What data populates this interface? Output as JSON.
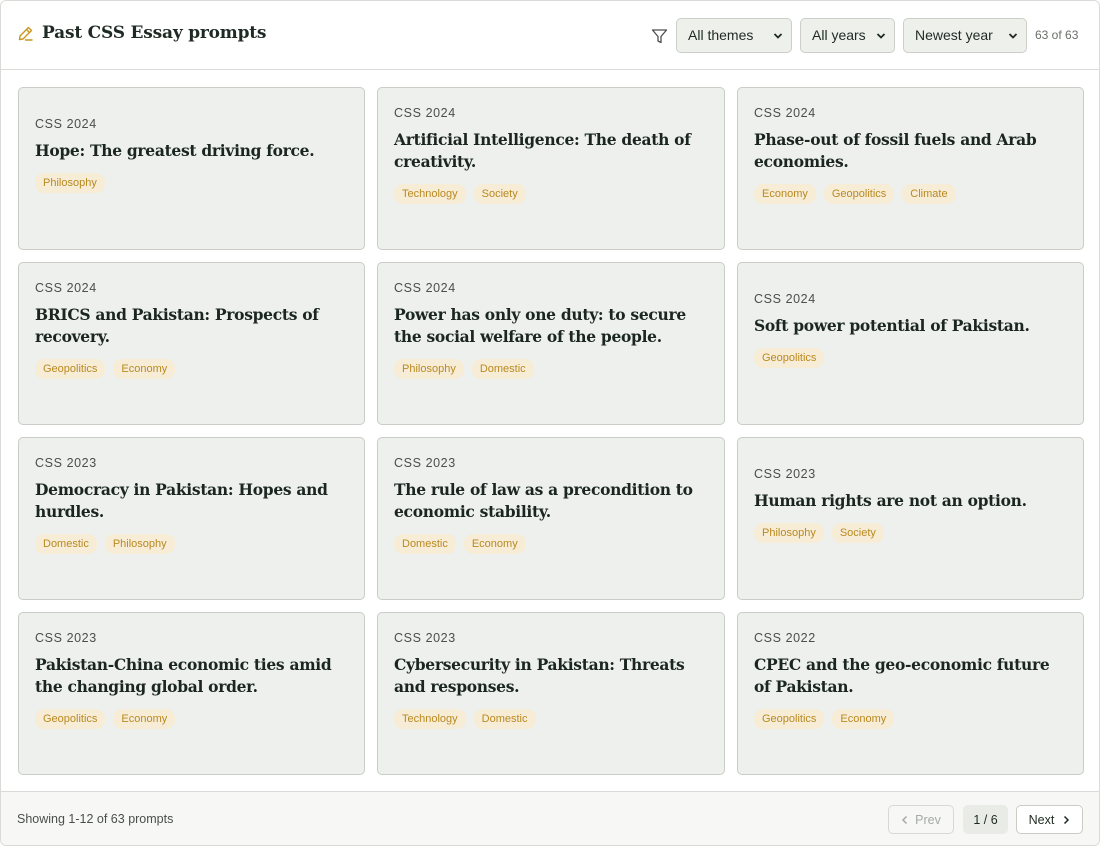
{
  "header": {
    "title": "Past CSS Essay prompts",
    "title_icon": "pencil-icon",
    "filter_icon": "filter-icon",
    "theme_select": "All themes",
    "year_select": "All years",
    "sort_select": "Newest year",
    "count": "63 of 63"
  },
  "cards": [
    {
      "year": "CSS 2024",
      "prompt": "Hope: The greatest driving force.",
      "tags": [
        "Philosophy"
      ]
    },
    {
      "year": "CSS 2024",
      "prompt": "Artificial Intelligence: The death of creativity.",
      "tags": [
        "Technology",
        "Society"
      ]
    },
    {
      "year": "CSS 2024",
      "prompt": "Phase-out of fossil fuels and Arab economies.",
      "tags": [
        "Economy",
        "Geopolitics",
        "Climate"
      ]
    },
    {
      "year": "CSS 2024",
      "prompt": "BRICS and Pakistan: Prospects of recovery.",
      "tags": [
        "Geopolitics",
        "Economy"
      ]
    },
    {
      "year": "CSS 2024",
      "prompt": "Power has only one duty: to secure the social welfare of the people.",
      "tags": [
        "Philosophy",
        "Domestic"
      ]
    },
    {
      "year": "CSS 2024",
      "prompt": "Soft power potential of Pakistan.",
      "tags": [
        "Geopolitics"
      ]
    },
    {
      "year": "CSS 2023",
      "prompt": "Democracy in Pakistan: Hopes and hurdles.",
      "tags": [
        "Domestic",
        "Philosophy"
      ]
    },
    {
      "year": "CSS 2023",
      "prompt": "The rule of law as a precondition to economic stability.",
      "tags": [
        "Domestic",
        "Economy"
      ]
    },
    {
      "year": "CSS 2023",
      "prompt": "Human rights are not an option.",
      "tags": [
        "Philosophy",
        "Society"
      ]
    },
    {
      "year": "CSS 2023",
      "prompt": "Pakistan-China economic ties amid the changing global order.",
      "tags": [
        "Geopolitics",
        "Economy"
      ]
    },
    {
      "year": "CSS 2023",
      "prompt": "Cybersecurity in Pakistan: Threats and responses.",
      "tags": [
        "Technology",
        "Domestic"
      ]
    },
    {
      "year": "CSS 2022",
      "prompt": "CPEC and the geo-economic future of Pakistan.",
      "tags": [
        "Geopolitics",
        "Economy"
      ]
    }
  ],
  "footer": {
    "showing": "Showing 1-12 of 63 prompts",
    "prev_label": "Prev",
    "page_indicator": "1 / 6",
    "next_label": "Next"
  },
  "colors": {
    "accent": "#c9961e",
    "card_bg": "#edf0ec",
    "tag_bg": "#f7ecd6",
    "tag_text": "#b98a21"
  }
}
